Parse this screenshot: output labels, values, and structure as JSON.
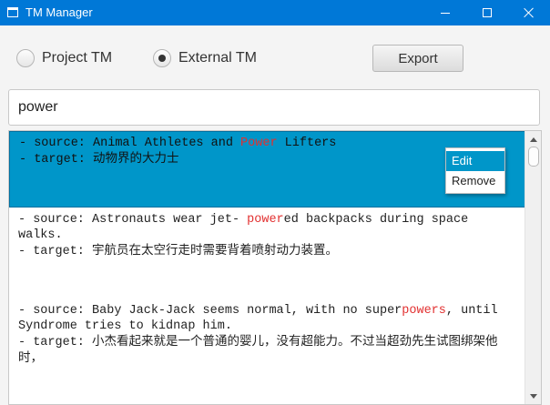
{
  "window": {
    "title": "TM Manager",
    "accent": "#0078d7"
  },
  "options": {
    "project_label": "Project TM",
    "external_label": "External TM",
    "selected": "External TM"
  },
  "toolbar": {
    "export_label": "Export"
  },
  "search": {
    "value": "power"
  },
  "entries": [
    {
      "source_prefix": "- source: ",
      "source_parts": [
        "Animal Athletes and ",
        "Power",
        " Lifters"
      ],
      "target_prefix": "- target: ",
      "target": "动物界的大力士",
      "selected": true
    },
    {
      "source_prefix": "- source: ",
      "source_parts": [
        "Astronauts wear jet- ",
        "power",
        "ed backpacks during space walks."
      ],
      "target_prefix": "- target: ",
      "target": "宇航员在太空行走时需要背着喷射动力装置。",
      "selected": false
    },
    {
      "source_prefix": "- source: ",
      "source_parts": [
        "Baby Jack-Jack seems normal, with no super",
        "powers",
        ", until Syndrome tries to kidnap him."
      ],
      "target_prefix": "- target: ",
      "target": "小杰看起来就是一个普通的婴儿，没有超能力。不过当超劲先生试图绑架他时，",
      "selected": false
    }
  ],
  "context_menu": {
    "items": [
      "Edit",
      "Remove"
    ],
    "active": "Edit"
  },
  "colors": {
    "highlight": "#e23030",
    "selection": "#0096c9"
  }
}
